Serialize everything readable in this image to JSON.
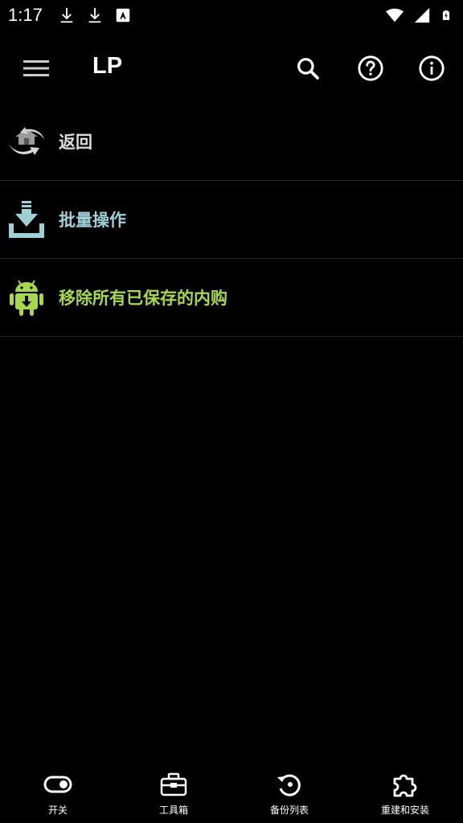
{
  "status_bar": {
    "time": "1:17",
    "icons": [
      "download-icon",
      "download-icon",
      "a-icon",
      "wifi-icon",
      "signal-icon",
      "battery-icon"
    ]
  },
  "app_bar": {
    "title": "LP",
    "actions": [
      "search-icon",
      "help-icon",
      "info-icon"
    ]
  },
  "list": {
    "items": [
      {
        "label": "返回",
        "icon": "back-icon",
        "color": "#dcdcdc"
      },
      {
        "label": "批量操作",
        "icon": "batch-download-icon",
        "color": "#9ed0d8"
      },
      {
        "label": "移除所有已保存的内购",
        "icon": "android-remove-icon",
        "color": "#a6d94a"
      }
    ]
  },
  "bottom_nav": {
    "items": [
      {
        "label": "开关",
        "icon": "toggle-icon"
      },
      {
        "label": "工具箱",
        "icon": "toolbox-icon"
      },
      {
        "label": "备份列表",
        "icon": "backup-icon"
      },
      {
        "label": "重建和安装",
        "icon": "puzzle-icon"
      }
    ]
  },
  "colors": {
    "background": "#000000",
    "divider": "#2a2a2a",
    "text": "#ffffff"
  }
}
